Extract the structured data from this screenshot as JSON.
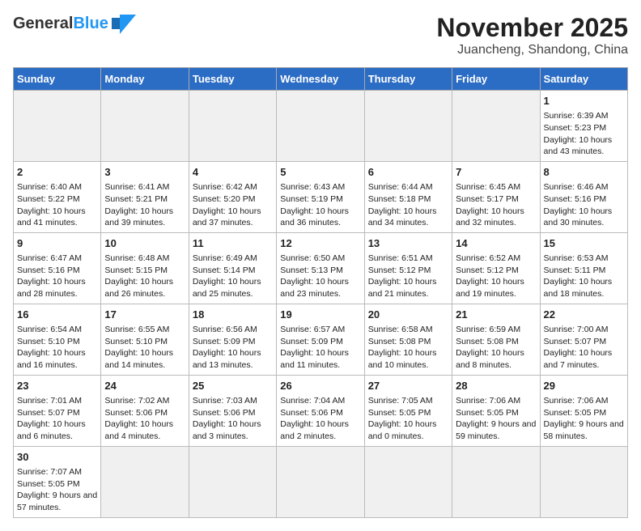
{
  "header": {
    "logo_general": "General",
    "logo_blue": "Blue",
    "title": "November 2025",
    "subtitle": "Juancheng, Shandong, China"
  },
  "days_of_week": [
    "Sunday",
    "Monday",
    "Tuesday",
    "Wednesday",
    "Thursday",
    "Friday",
    "Saturday"
  ],
  "weeks": [
    [
      {
        "day": "",
        "info": ""
      },
      {
        "day": "",
        "info": ""
      },
      {
        "day": "",
        "info": ""
      },
      {
        "day": "",
        "info": ""
      },
      {
        "day": "",
        "info": ""
      },
      {
        "day": "",
        "info": ""
      },
      {
        "day": "1",
        "info": "Sunrise: 6:39 AM\nSunset: 5:23 PM\nDaylight: 10 hours and 43 minutes."
      }
    ],
    [
      {
        "day": "2",
        "info": "Sunrise: 6:40 AM\nSunset: 5:22 PM\nDaylight: 10 hours and 41 minutes."
      },
      {
        "day": "3",
        "info": "Sunrise: 6:41 AM\nSunset: 5:21 PM\nDaylight: 10 hours and 39 minutes."
      },
      {
        "day": "4",
        "info": "Sunrise: 6:42 AM\nSunset: 5:20 PM\nDaylight: 10 hours and 37 minutes."
      },
      {
        "day": "5",
        "info": "Sunrise: 6:43 AM\nSunset: 5:19 PM\nDaylight: 10 hours and 36 minutes."
      },
      {
        "day": "6",
        "info": "Sunrise: 6:44 AM\nSunset: 5:18 PM\nDaylight: 10 hours and 34 minutes."
      },
      {
        "day": "7",
        "info": "Sunrise: 6:45 AM\nSunset: 5:17 PM\nDaylight: 10 hours and 32 minutes."
      },
      {
        "day": "8",
        "info": "Sunrise: 6:46 AM\nSunset: 5:16 PM\nDaylight: 10 hours and 30 minutes."
      }
    ],
    [
      {
        "day": "9",
        "info": "Sunrise: 6:47 AM\nSunset: 5:16 PM\nDaylight: 10 hours and 28 minutes."
      },
      {
        "day": "10",
        "info": "Sunrise: 6:48 AM\nSunset: 5:15 PM\nDaylight: 10 hours and 26 minutes."
      },
      {
        "day": "11",
        "info": "Sunrise: 6:49 AM\nSunset: 5:14 PM\nDaylight: 10 hours and 25 minutes."
      },
      {
        "day": "12",
        "info": "Sunrise: 6:50 AM\nSunset: 5:13 PM\nDaylight: 10 hours and 23 minutes."
      },
      {
        "day": "13",
        "info": "Sunrise: 6:51 AM\nSunset: 5:12 PM\nDaylight: 10 hours and 21 minutes."
      },
      {
        "day": "14",
        "info": "Sunrise: 6:52 AM\nSunset: 5:12 PM\nDaylight: 10 hours and 19 minutes."
      },
      {
        "day": "15",
        "info": "Sunrise: 6:53 AM\nSunset: 5:11 PM\nDaylight: 10 hours and 18 minutes."
      }
    ],
    [
      {
        "day": "16",
        "info": "Sunrise: 6:54 AM\nSunset: 5:10 PM\nDaylight: 10 hours and 16 minutes."
      },
      {
        "day": "17",
        "info": "Sunrise: 6:55 AM\nSunset: 5:10 PM\nDaylight: 10 hours and 14 minutes."
      },
      {
        "day": "18",
        "info": "Sunrise: 6:56 AM\nSunset: 5:09 PM\nDaylight: 10 hours and 13 minutes."
      },
      {
        "day": "19",
        "info": "Sunrise: 6:57 AM\nSunset: 5:09 PM\nDaylight: 10 hours and 11 minutes."
      },
      {
        "day": "20",
        "info": "Sunrise: 6:58 AM\nSunset: 5:08 PM\nDaylight: 10 hours and 10 minutes."
      },
      {
        "day": "21",
        "info": "Sunrise: 6:59 AM\nSunset: 5:08 PM\nDaylight: 10 hours and 8 minutes."
      },
      {
        "day": "22",
        "info": "Sunrise: 7:00 AM\nSunset: 5:07 PM\nDaylight: 10 hours and 7 minutes."
      }
    ],
    [
      {
        "day": "23",
        "info": "Sunrise: 7:01 AM\nSunset: 5:07 PM\nDaylight: 10 hours and 6 minutes."
      },
      {
        "day": "24",
        "info": "Sunrise: 7:02 AM\nSunset: 5:06 PM\nDaylight: 10 hours and 4 minutes."
      },
      {
        "day": "25",
        "info": "Sunrise: 7:03 AM\nSunset: 5:06 PM\nDaylight: 10 hours and 3 minutes."
      },
      {
        "day": "26",
        "info": "Sunrise: 7:04 AM\nSunset: 5:06 PM\nDaylight: 10 hours and 2 minutes."
      },
      {
        "day": "27",
        "info": "Sunrise: 7:05 AM\nSunset: 5:05 PM\nDaylight: 10 hours and 0 minutes."
      },
      {
        "day": "28",
        "info": "Sunrise: 7:06 AM\nSunset: 5:05 PM\nDaylight: 9 hours and 59 minutes."
      },
      {
        "day": "29",
        "info": "Sunrise: 7:06 AM\nSunset: 5:05 PM\nDaylight: 9 hours and 58 minutes."
      }
    ],
    [
      {
        "day": "30",
        "info": "Sunrise: 7:07 AM\nSunset: 5:05 PM\nDaylight: 9 hours and 57 minutes."
      },
      {
        "day": "",
        "info": ""
      },
      {
        "day": "",
        "info": ""
      },
      {
        "day": "",
        "info": ""
      },
      {
        "day": "",
        "info": ""
      },
      {
        "day": "",
        "info": ""
      },
      {
        "day": "",
        "info": ""
      }
    ]
  ]
}
